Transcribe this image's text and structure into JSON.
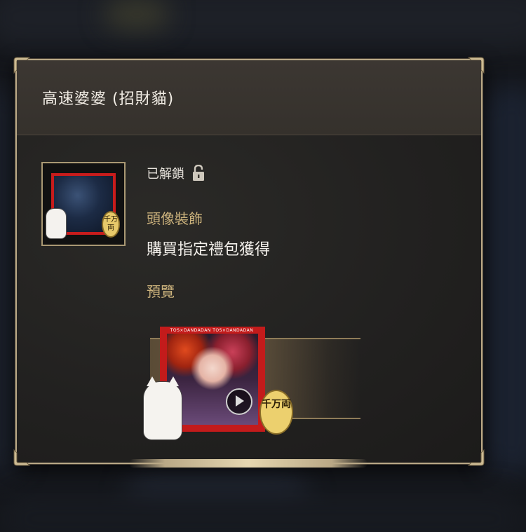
{
  "dialog": {
    "title": "高速婆婆 (招財貓)",
    "status": {
      "text": "已解鎖",
      "icon": "unlocked-padlock-icon"
    },
    "category": "頭像裝飾",
    "description": "購買指定禮包獲得",
    "preview_label": "預覽"
  },
  "thumbnail": {
    "coin_text": "千万両"
  },
  "preview": {
    "coin_text": "千万両",
    "frame_text": "TOS×DANDADAN TOS×DANDADAN"
  },
  "colors": {
    "accent_gold": "#cbb27c",
    "frame_red": "#c71c1c",
    "border_gold": "#b9a886"
  }
}
